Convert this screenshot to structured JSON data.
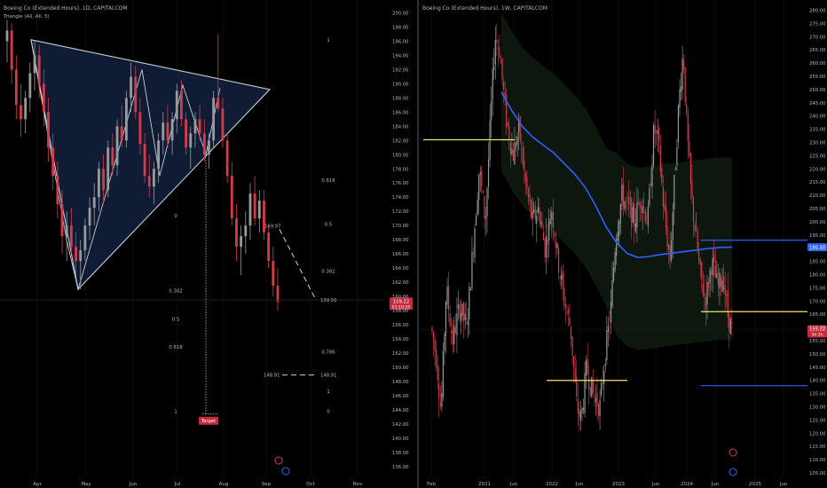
{
  "theme": {
    "bg": "#000000",
    "text": "#b2b5be",
    "bull": "#9a9a9a",
    "bear": "#d63b4a",
    "ma": "#2962ff",
    "level_yellow": "#f5e663",
    "level_blue": "#2962ff",
    "price_tag": "#c62a3b",
    "ma_tag": "#2962ff",
    "triangle_fill": "#101c34"
  },
  "chart_data": [
    {
      "type": "candlestick",
      "title": "Boeing Co (Extended Hours), 1D, CAPITALCOM",
      "subtitle": "Triangle (All, All, 5)",
      "timeframe": "1D",
      "x_ticks": [
        "Apr",
        "May",
        "Jun",
        "Jul",
        "Aug",
        "Sep",
        "Oct",
        "Nov"
      ],
      "y_ticks": [
        "200.00",
        "198.00",
        "196.00",
        "194.00",
        "192.00",
        "190.00",
        "188.00",
        "186.00",
        "184.00",
        "182.00",
        "180.00",
        "178.00",
        "176.00",
        "174.00",
        "172.00",
        "170.00",
        "168.00",
        "166.00",
        "164.00",
        "162.00",
        "160.00",
        "158.00",
        "156.00",
        "154.00",
        "152.00",
        "150.00",
        "148.00",
        "146.00",
        "144.00",
        "142.00",
        "140.00",
        "138.00",
        "136.00"
      ],
      "ylim": [
        134.6,
        201.0
      ],
      "last_price": "159.22",
      "countdown": "01:10:59",
      "triangle": {
        "top": 196.2,
        "apex": 189.2,
        "bottom": 161.0
      },
      "breakdown_line": 159.5,
      "target": {
        "label": "Target",
        "price": 143.4
      },
      "projection": {
        "start_label": "169.97",
        "end_label": "159.50",
        "level_left": "148.91",
        "level_right": "148.91",
        "start": 169.97,
        "end": 159.5,
        "level": 148.91
      },
      "fib_labels": [
        {
          "text": "1",
          "price": 196.2,
          "side": "right"
        },
        {
          "text": "0.618",
          "price": 176.4,
          "side": "right"
        },
        {
          "text": "0",
          "price": 171.4,
          "side": "left"
        },
        {
          "text": "0.5",
          "price": 170.2,
          "side": "right"
        },
        {
          "text": "0.382",
          "price": 163.6,
          "side": "right"
        },
        {
          "text": "0.382",
          "price": 160.8,
          "side": "left"
        },
        {
          "text": "0.5",
          "price": 156.8,
          "side": "left"
        },
        {
          "text": "0.618",
          "price": 152.9,
          "side": "left"
        },
        {
          "text": "0.786",
          "price": 152.2,
          "side": "right"
        },
        {
          "text": "1",
          "price": 146.6,
          "side": "right"
        },
        {
          "text": "1",
          "price": 143.8,
          "side": "left"
        },
        {
          "text": "0",
          "price": 143.8,
          "side": "right"
        }
      ],
      "candles": [
        {
          "o": 196,
          "h": 199,
          "l": 193,
          "c": 197.5
        },
        {
          "o": 197.5,
          "h": 198.5,
          "l": 190,
          "c": 192
        },
        {
          "o": 192,
          "h": 194,
          "l": 185,
          "c": 187
        },
        {
          "o": 187,
          "h": 190,
          "l": 182.5,
          "c": 185
        },
        {
          "o": 185,
          "h": 189,
          "l": 183,
          "c": 188
        },
        {
          "o": 188,
          "h": 193,
          "l": 186,
          "c": 191.5
        },
        {
          "o": 191.5,
          "h": 196,
          "l": 189,
          "c": 194
        },
        {
          "o": 194,
          "h": 195.5,
          "l": 188,
          "c": 190
        },
        {
          "o": 190,
          "h": 192,
          "l": 184,
          "c": 186
        },
        {
          "o": 186,
          "h": 188,
          "l": 179,
          "c": 181
        },
        {
          "o": 181,
          "h": 183,
          "l": 175,
          "c": 177
        },
        {
          "o": 177,
          "h": 179,
          "l": 171,
          "c": 173
        },
        {
          "o": 173,
          "h": 175,
          "l": 166,
          "c": 168.5
        },
        {
          "o": 168.5,
          "h": 172,
          "l": 165,
          "c": 170
        },
        {
          "o": 170,
          "h": 172.5,
          "l": 166,
          "c": 167
        },
        {
          "o": 167,
          "h": 169,
          "l": 163,
          "c": 165
        },
        {
          "o": 165,
          "h": 168,
          "l": 161,
          "c": 166.5
        },
        {
          "o": 166.5,
          "h": 171,
          "l": 165,
          "c": 170
        },
        {
          "o": 170,
          "h": 174,
          "l": 168,
          "c": 172.5
        },
        {
          "o": 172.5,
          "h": 176,
          "l": 170,
          "c": 174
        },
        {
          "o": 174,
          "h": 179,
          "l": 172,
          "c": 178
        },
        {
          "o": 178,
          "h": 180,
          "l": 173,
          "c": 175
        },
        {
          "o": 175,
          "h": 182,
          "l": 174,
          "c": 181
        },
        {
          "o": 181,
          "h": 183,
          "l": 177,
          "c": 178.5
        },
        {
          "o": 178.5,
          "h": 185,
          "l": 177,
          "c": 184
        },
        {
          "o": 184,
          "h": 187,
          "l": 181,
          "c": 182
        },
        {
          "o": 182,
          "h": 189,
          "l": 181,
          "c": 188
        },
        {
          "o": 188,
          "h": 193,
          "l": 186,
          "c": 191
        },
        {
          "o": 191,
          "h": 192.5,
          "l": 185,
          "c": 186
        },
        {
          "o": 186,
          "h": 188,
          "l": 180,
          "c": 181.5
        },
        {
          "o": 181.5,
          "h": 183,
          "l": 176,
          "c": 177
        },
        {
          "o": 177,
          "h": 180,
          "l": 174,
          "c": 175.5
        },
        {
          "o": 175.5,
          "h": 179,
          "l": 173,
          "c": 178
        },
        {
          "o": 178,
          "h": 183,
          "l": 176,
          "c": 182
        },
        {
          "o": 182,
          "h": 186,
          "l": 180,
          "c": 184.5
        },
        {
          "o": 184.5,
          "h": 187,
          "l": 181,
          "c": 182
        },
        {
          "o": 182,
          "h": 186,
          "l": 180,
          "c": 185
        },
        {
          "o": 185,
          "h": 190,
          "l": 183,
          "c": 189
        },
        {
          "o": 189,
          "h": 190.5,
          "l": 184,
          "c": 185
        },
        {
          "o": 185,
          "h": 186,
          "l": 180,
          "c": 181
        },
        {
          "o": 181,
          "h": 184,
          "l": 178,
          "c": 183
        },
        {
          "o": 183,
          "h": 186,
          "l": 181,
          "c": 185
        },
        {
          "o": 185,
          "h": 187,
          "l": 182,
          "c": 183
        },
        {
          "o": 183,
          "h": 185,
          "l": 179,
          "c": 180
        },
        {
          "o": 180,
          "h": 183,
          "l": 178,
          "c": 182
        },
        {
          "o": 182,
          "h": 189,
          "l": 181,
          "c": 188
        },
        {
          "o": 188,
          "h": 197,
          "l": 186,
          "c": 186.5
        },
        {
          "o": 186.5,
          "h": 188,
          "l": 181,
          "c": 182
        },
        {
          "o": 182,
          "h": 183,
          "l": 176,
          "c": 177
        },
        {
          "o": 177,
          "h": 179,
          "l": 170,
          "c": 171
        },
        {
          "o": 171,
          "h": 173,
          "l": 165,
          "c": 167
        },
        {
          "o": 167,
          "h": 170,
          "l": 163,
          "c": 168.5
        },
        {
          "o": 168.5,
          "h": 172,
          "l": 166,
          "c": 170
        },
        {
          "o": 170,
          "h": 176,
          "l": 168,
          "c": 174.5
        },
        {
          "o": 174.5,
          "h": 177,
          "l": 170,
          "c": 171
        },
        {
          "o": 171,
          "h": 175,
          "l": 169,
          "c": 173.5
        },
        {
          "o": 173.5,
          "h": 175,
          "l": 168,
          "c": 169
        },
        {
          "o": 169,
          "h": 170,
          "l": 164,
          "c": 165
        },
        {
          "o": 165,
          "h": 167,
          "l": 160,
          "c": 161.5
        },
        {
          "o": 161.5,
          "h": 164,
          "l": 158,
          "c": 159.22
        }
      ]
    },
    {
      "type": "candlestick",
      "title": "Boeing Co (Extended Hours), 1W, CAPITALCOM",
      "timeframe": "1W",
      "x_ticks": [
        "Feb",
        "2021",
        "Jun",
        "2022",
        "Jun",
        "2023",
        "Jun",
        "2024",
        "Jun",
        "2025",
        "Jun"
      ],
      "y_ticks": [
        "280.00",
        "275.00",
        "270.00",
        "265.00",
        "260.00",
        "255.00",
        "250.00",
        "245.00",
        "240.00",
        "235.00",
        "230.00",
        "225.00",
        "220.00",
        "215.00",
        "210.00",
        "205.00",
        "200.00",
        "195.00",
        "190.00",
        "185.00",
        "180.00",
        "175.00",
        "170.00",
        "165.00",
        "160.00",
        "155.00",
        "150.00",
        "145.00",
        "140.00",
        "135.00",
        "130.00",
        "125.00",
        "120.00",
        "115.00",
        "110.00",
        "105.00"
      ],
      "ylim": [
        103.0,
        281.5
      ],
      "last_price": "159.22",
      "countdown": "3d 2h",
      "ma_value": "190.37",
      "levels": [
        {
          "price": 231.0,
          "color": "yellow"
        },
        {
          "price": 140.0,
          "color": "yellow"
        },
        {
          "price": 166.0,
          "color": "yellow"
        },
        {
          "price": 193.0,
          "color": "blue"
        },
        {
          "price": 138.0,
          "color": "blue"
        }
      ],
      "ma": [
        249,
        242,
        236,
        232,
        229,
        226,
        222,
        218,
        213,
        206,
        198,
        192,
        188,
        186.5,
        186.8,
        187.5,
        188,
        188.5,
        189,
        189.5,
        190,
        190.3,
        190.37
      ],
      "series_hint": "weekly candles 2020-11 to 2024-09"
    }
  ]
}
